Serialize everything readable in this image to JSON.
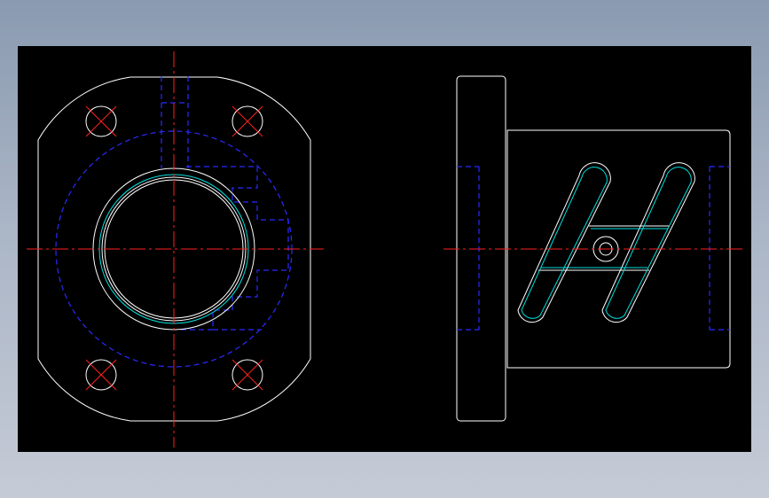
{
  "drawing": {
    "type": "cad-two-view",
    "views": [
      "front-view-flange",
      "side-view-housing"
    ],
    "colors": {
      "background": "#000000",
      "outline": "#ffffff",
      "centerline": "#ff2020",
      "hidden": "#2a2aff",
      "cyan": "#00e0e0"
    }
  }
}
